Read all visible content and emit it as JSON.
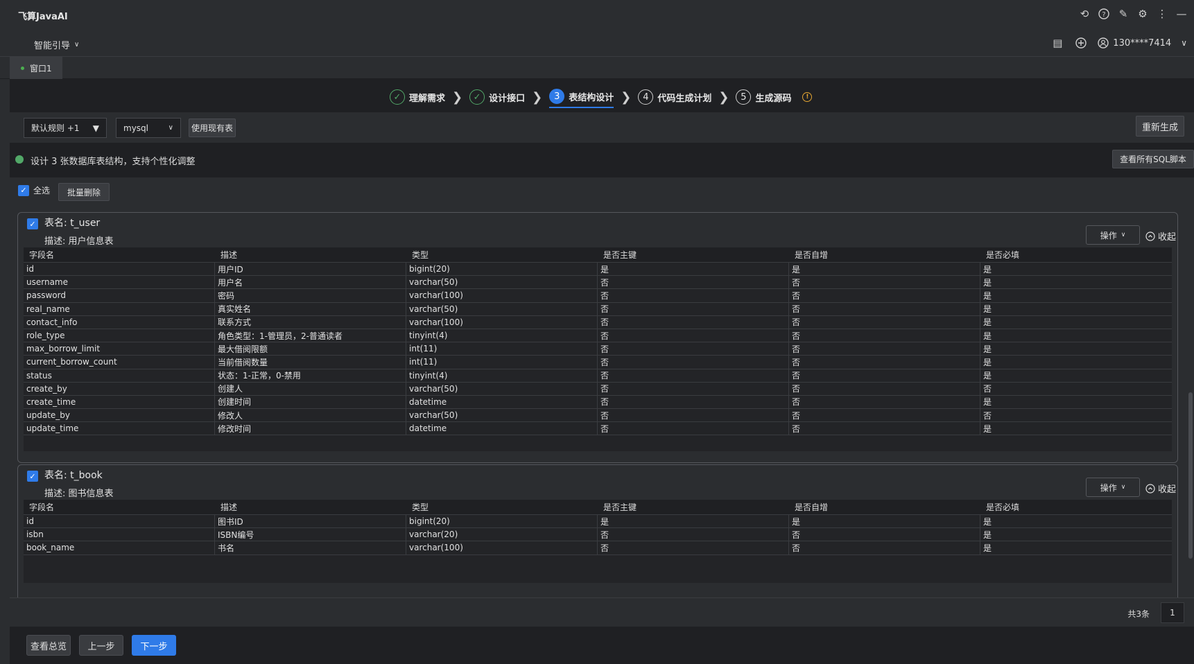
{
  "app_title": "飞算JavaAI",
  "subbar": {
    "guide_label": "智能引导",
    "user_label": "130****7414"
  },
  "tabs": [
    {
      "label": "窗口1"
    }
  ],
  "steps": [
    {
      "label": "理解需求",
      "state": "done",
      "num": ""
    },
    {
      "label": "设计接口",
      "state": "done",
      "num": ""
    },
    {
      "label": "表结构设计",
      "state": "active",
      "num": "3"
    },
    {
      "label": "代码生成计划",
      "state": "pending",
      "num": "4"
    },
    {
      "label": "生成源码",
      "state": "pending",
      "num": "5"
    }
  ],
  "toolbar": {
    "rule_select": "默认规则 +1",
    "db_select": "mysql",
    "use_existing": "使用现有表",
    "regenerate": "重新生成"
  },
  "info": {
    "text": "设计 3 张数据库表结构，支持个性化调整",
    "view_sql": "查看所有SQL脚本"
  },
  "bulk": {
    "select_all": "全选",
    "batch_delete": "批量删除"
  },
  "headers": [
    "字段名",
    "描述",
    "类型",
    "是否主键",
    "是否自增",
    "是否必填"
  ],
  "op_label": "操作",
  "collapse_label": "收起",
  "tables": [
    {
      "title": "表名: t_user",
      "desc": "描述: 用户信息表",
      "rows": [
        [
          "id",
          "用户ID",
          "bigint(20)",
          "是",
          "是",
          "是"
        ],
        [
          "username",
          "用户名",
          "varchar(50)",
          "否",
          "否",
          "是"
        ],
        [
          "password",
          "密码",
          "varchar(100)",
          "否",
          "否",
          "是"
        ],
        [
          "real_name",
          "真实姓名",
          "varchar(50)",
          "否",
          "否",
          "是"
        ],
        [
          "contact_info",
          "联系方式",
          "varchar(100)",
          "否",
          "否",
          "是"
        ],
        [
          "role_type",
          "角色类型：1-管理员，2-普通读者",
          "tinyint(4)",
          "否",
          "否",
          "是"
        ],
        [
          "max_borrow_limit",
          "最大借阅限额",
          "int(11)",
          "否",
          "否",
          "是"
        ],
        [
          "current_borrow_count",
          "当前借阅数量",
          "int(11)",
          "否",
          "否",
          "是"
        ],
        [
          "status",
          "状态：1-正常，0-禁用",
          "tinyint(4)",
          "否",
          "否",
          "是"
        ],
        [
          "create_by",
          "创建人",
          "varchar(50)",
          "否",
          "否",
          "否"
        ],
        [
          "create_time",
          "创建时间",
          "datetime",
          "否",
          "否",
          "是"
        ],
        [
          "update_by",
          "修改人",
          "varchar(50)",
          "否",
          "否",
          "否"
        ],
        [
          "update_time",
          "修改时间",
          "datetime",
          "否",
          "否",
          "是"
        ]
      ]
    },
    {
      "title": "表名: t_book",
      "desc": "描述: 图书信息表",
      "rows": [
        [
          "id",
          "图书ID",
          "bigint(20)",
          "是",
          "是",
          "是"
        ],
        [
          "isbn",
          "ISBN编号",
          "varchar(20)",
          "否",
          "否",
          "是"
        ],
        [
          "book_name",
          "书名",
          "varchar(100)",
          "否",
          "否",
          "是"
        ]
      ]
    }
  ],
  "footer": {
    "total": "共3条",
    "page": "1"
  },
  "bottom": {
    "overview": "查看总览",
    "prev": "上一步",
    "next": "下一步"
  },
  "colors": {
    "accent": "#2f7be8",
    "success": "#52a868",
    "warning": "#e5a632"
  }
}
